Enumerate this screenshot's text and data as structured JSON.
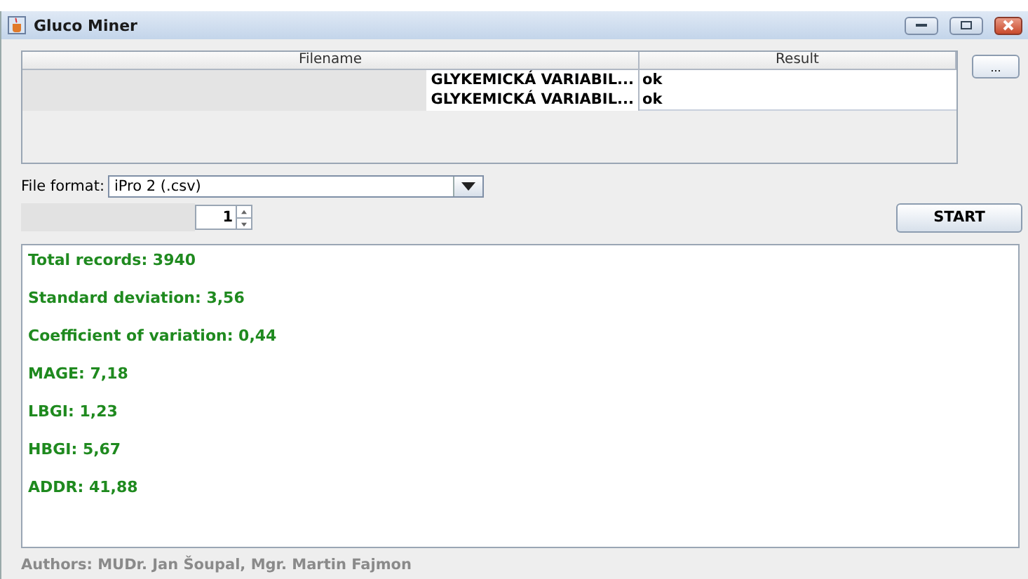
{
  "window": {
    "title": "Gluco Miner"
  },
  "table": {
    "columns": [
      "Filename",
      "Result"
    ],
    "rows": [
      {
        "filename": "GLYKEMICKÁ VARIABIL...",
        "result": "ok"
      },
      {
        "filename": "GLYKEMICKÁ VARIABIL...",
        "result": "ok"
      }
    ]
  },
  "browse_button": "...",
  "file_format": {
    "label": "File format:",
    "value": "iPro 2 (.csv)"
  },
  "spinner": {
    "value": "1"
  },
  "start_button": "START",
  "results": [
    "Total records: 3940",
    "Standard deviation: 3,56",
    "Coefficient of variation: 0,44",
    "MAGE: 7,18",
    "LBGI: 1,23",
    "HBGI: 5,67",
    "ADDR: 41,88"
  ],
  "status_bar": "Authors: MUDr. Jan Šoupal, Mgr. Martin Fajmon"
}
